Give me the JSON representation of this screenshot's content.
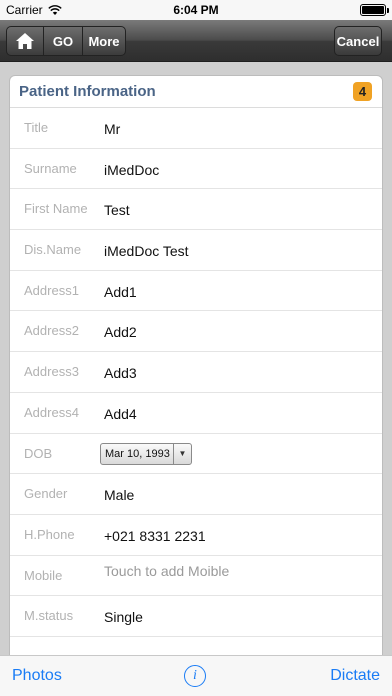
{
  "status_bar": {
    "carrier": "Carrier",
    "time": "6:04 PM"
  },
  "nav": {
    "go_label": "GO",
    "more_label": "More",
    "cancel_label": "Cancel"
  },
  "panel": {
    "title": "Patient Information",
    "badge": "4"
  },
  "fields": [
    {
      "label": "Title",
      "value": "Mr"
    },
    {
      "label": "Surname",
      "value": "iMedDoc"
    },
    {
      "label": "First Name",
      "value": "Test"
    },
    {
      "label": "Dis.Name",
      "value": "iMedDoc Test"
    },
    {
      "label": "Address1",
      "value": "Add1"
    },
    {
      "label": "Address2",
      "value": "Add2"
    },
    {
      "label": "Address3",
      "value": "Add3"
    },
    {
      "label": "Address4",
      "value": "Add4"
    },
    {
      "label": "DOB",
      "value": "Mar 10, 1993"
    },
    {
      "label": "Gender",
      "value": "Male"
    },
    {
      "label": "H.Phone",
      "value": "+021 8331 2231"
    },
    {
      "label": "Mobile",
      "placeholder": "Touch to add Moible"
    },
    {
      "label": "M.status",
      "value": "Single"
    }
  ],
  "tabbar": {
    "left_label": "Photos",
    "info_label": "i",
    "right_label": "Dictate"
  },
  "colors": {
    "accent": "#1a7cf5",
    "title": "#4a6486",
    "badge": "#f0a224"
  }
}
